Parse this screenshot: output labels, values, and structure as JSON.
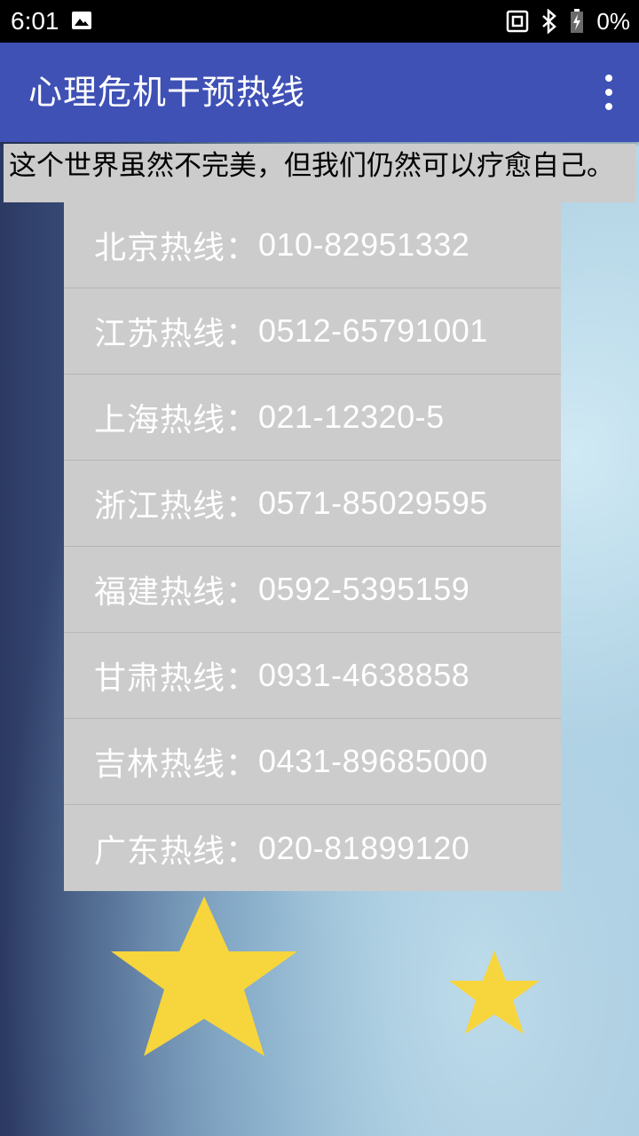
{
  "status_bar": {
    "time": "6:01",
    "battery_percent": "0%",
    "icons": [
      "image-icon",
      "nfc-icon",
      "bluetooth-icon",
      "battery-charging-icon"
    ]
  },
  "app_bar": {
    "title": "心理危机干预热线",
    "menu_icon": "overflow-menu-icon"
  },
  "quote": "这个世界虽然不完美，但我们仍然可以疗愈自己。",
  "hotlines": [
    {
      "label": "北京热线：",
      "number": "010-82951332"
    },
    {
      "label": "江苏热线：",
      "number": "0512-65791001"
    },
    {
      "label": "上海热线：",
      "number": "021-12320-5"
    },
    {
      "label": "浙江热线：",
      "number": "0571-85029595"
    },
    {
      "label": "福建热线：",
      "number": "0592-5395159"
    },
    {
      "label": "甘肃热线：",
      "number": "0931-4638858"
    },
    {
      "label": "吉林热线：",
      "number": "0431-89685000"
    },
    {
      "label": "广东热线：",
      "number": "020-81899120"
    }
  ],
  "colors": {
    "app_bar": "#3f51b5",
    "list_background": "#cccccc",
    "list_text": "#ffffff",
    "star": "#f7d53c"
  }
}
